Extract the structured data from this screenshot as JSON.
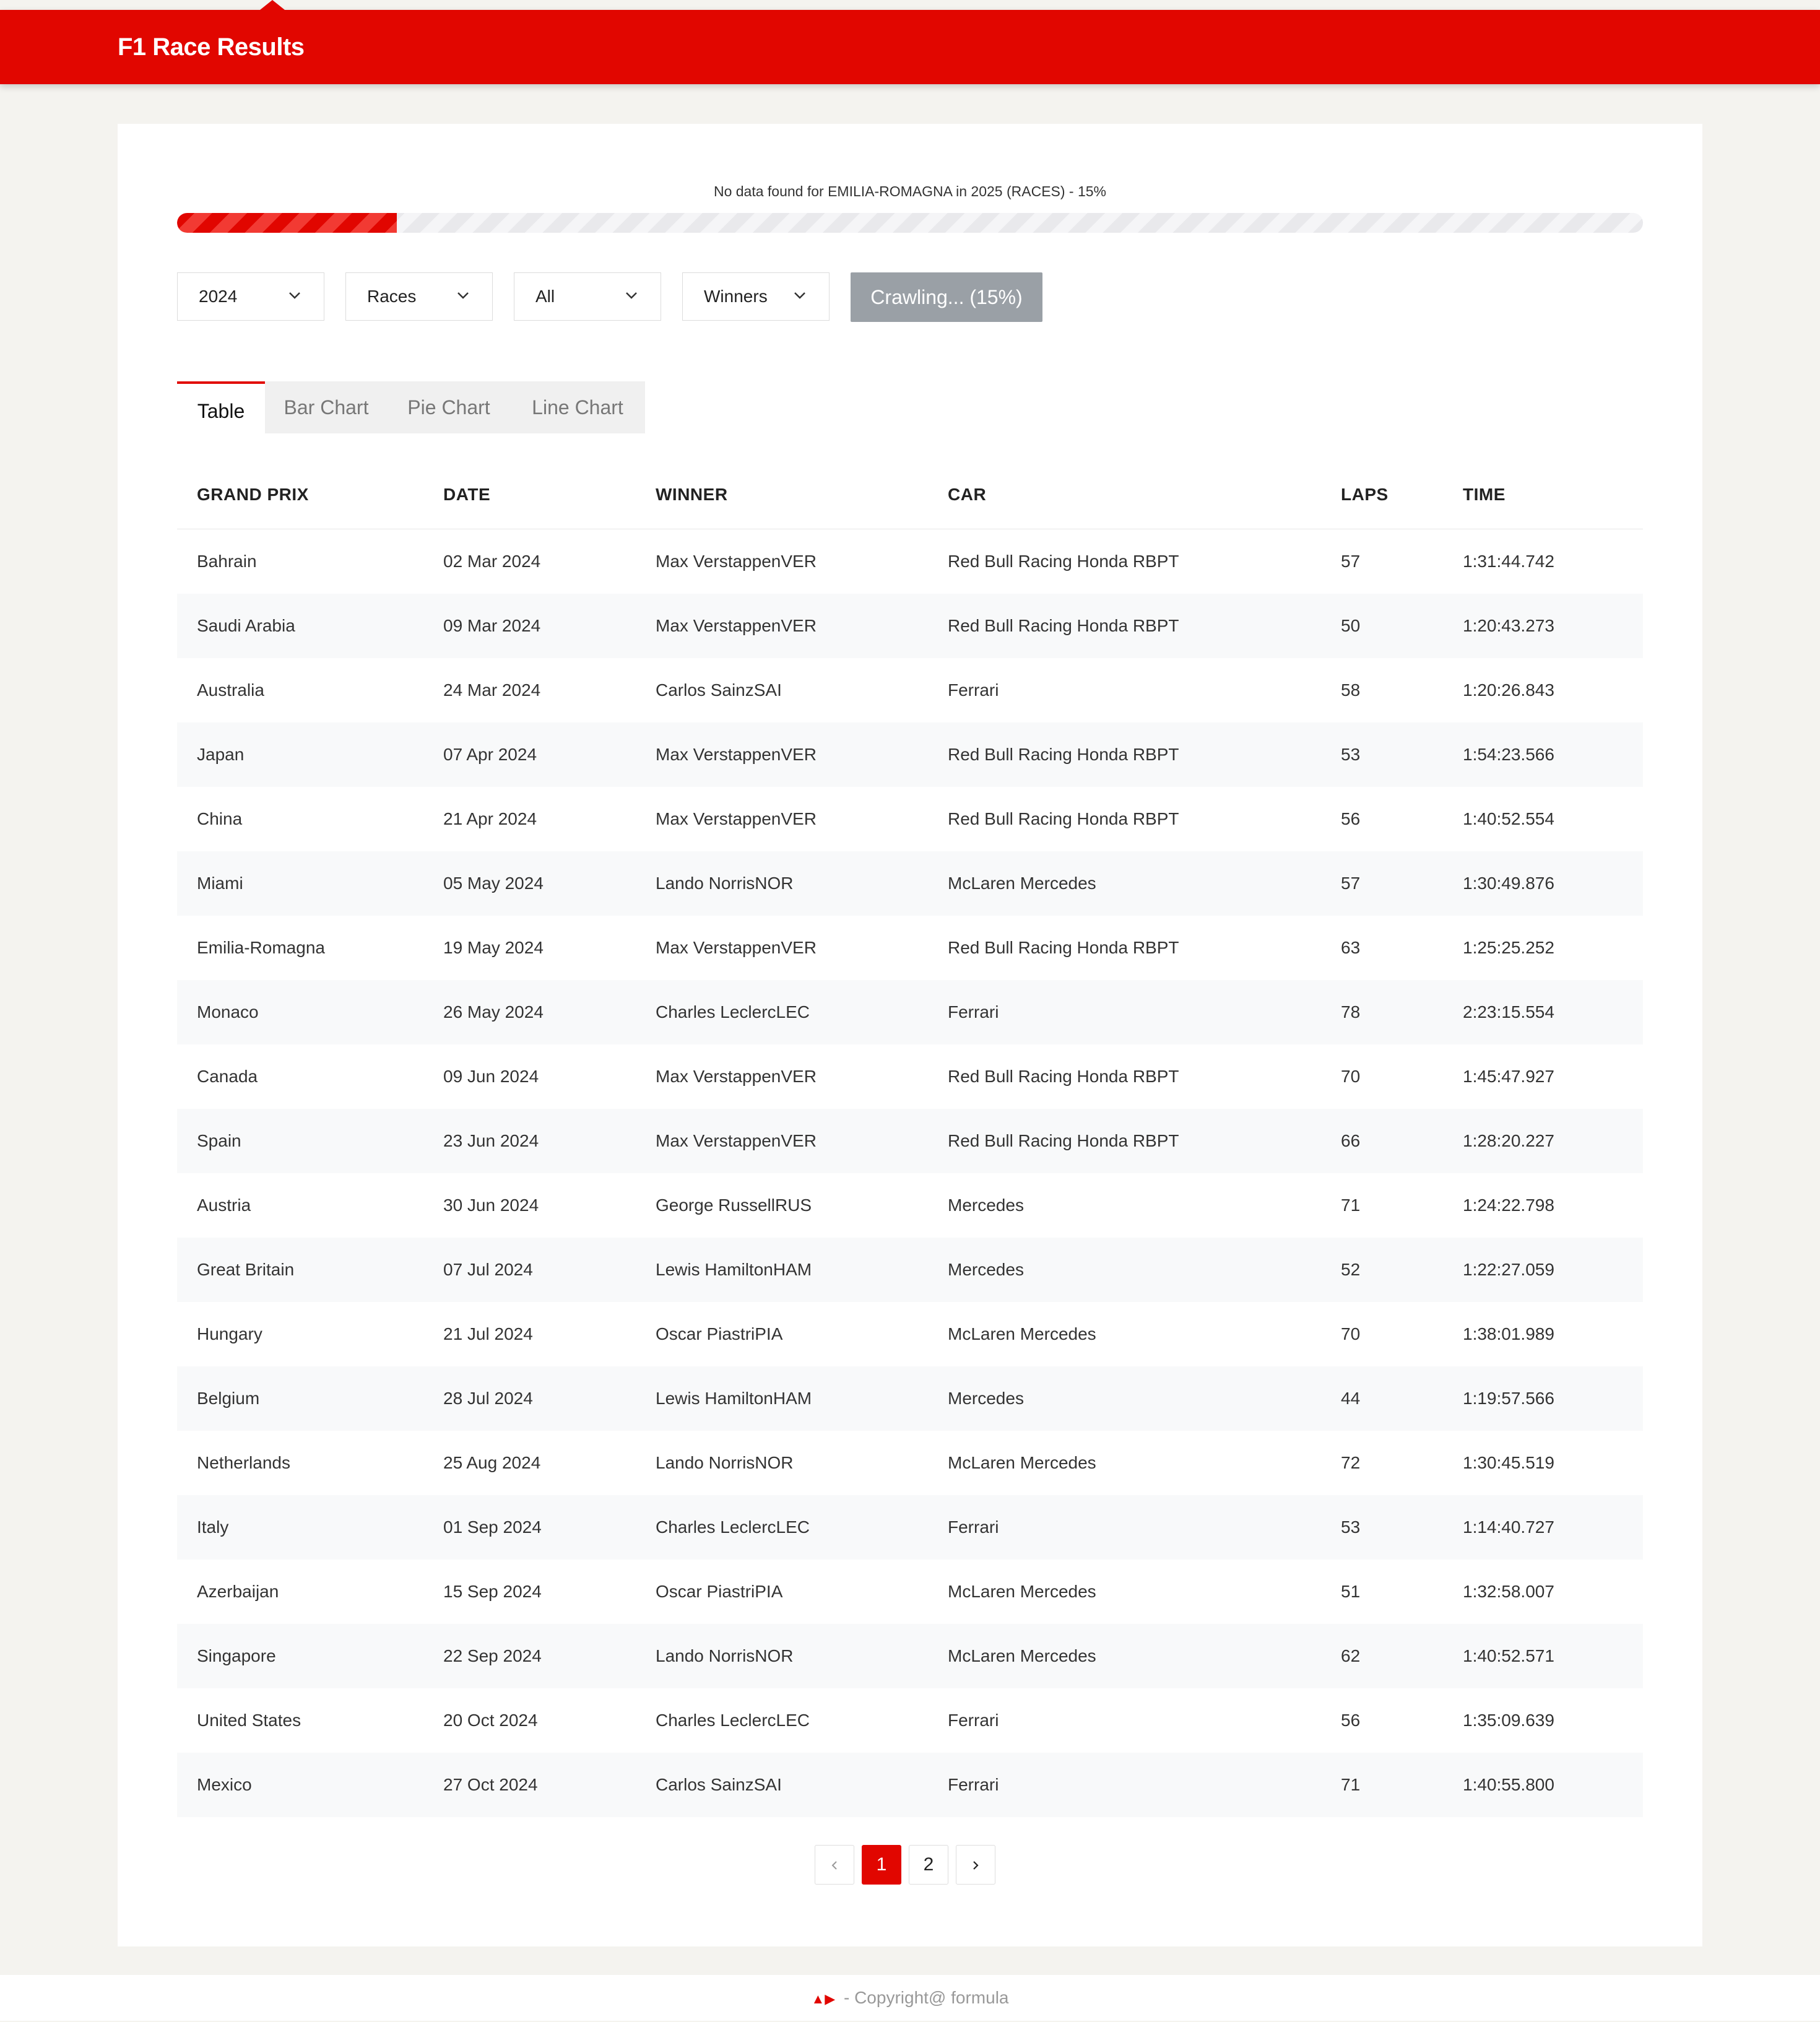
{
  "header": {
    "title": "F1 Race Results"
  },
  "progress": {
    "label": "No data found for EMILIA-ROMAGNA in 2025 (RACES) - 15%",
    "value": 0.15
  },
  "filters": {
    "year": "2024",
    "category": "Races",
    "scope": "All",
    "result_type": "Winners",
    "crawl_button": "Crawling... (15%)"
  },
  "tabs": [
    {
      "label": "Table",
      "active": true
    },
    {
      "label": "Bar Chart",
      "active": false
    },
    {
      "label": "Pie Chart",
      "active": false
    },
    {
      "label": "Line Chart",
      "active": false
    }
  ],
  "table": {
    "headers": [
      "GRAND PRIX",
      "DATE",
      "WINNER",
      "CAR",
      "LAPS",
      "TIME"
    ],
    "rows": [
      [
        "Bahrain",
        "02 Mar 2024",
        "Max VerstappenVER",
        "Red Bull Racing Honda RBPT",
        "57",
        "1:31:44.742"
      ],
      [
        "Saudi Arabia",
        "09 Mar 2024",
        "Max VerstappenVER",
        "Red Bull Racing Honda RBPT",
        "50",
        "1:20:43.273"
      ],
      [
        "Australia",
        "24 Mar 2024",
        "Carlos SainzSAI",
        "Ferrari",
        "58",
        "1:20:26.843"
      ],
      [
        "Japan",
        "07 Apr 2024",
        "Max VerstappenVER",
        "Red Bull Racing Honda RBPT",
        "53",
        "1:54:23.566"
      ],
      [
        "China",
        "21 Apr 2024",
        "Max VerstappenVER",
        "Red Bull Racing Honda RBPT",
        "56",
        "1:40:52.554"
      ],
      [
        "Miami",
        "05 May 2024",
        "Lando NorrisNOR",
        "McLaren Mercedes",
        "57",
        "1:30:49.876"
      ],
      [
        "Emilia-Romagna",
        "19 May 2024",
        "Max VerstappenVER",
        "Red Bull Racing Honda RBPT",
        "63",
        "1:25:25.252"
      ],
      [
        "Monaco",
        "26 May 2024",
        "Charles LeclercLEC",
        "Ferrari",
        "78",
        "2:23:15.554"
      ],
      [
        "Canada",
        "09 Jun 2024",
        "Max VerstappenVER",
        "Red Bull Racing Honda RBPT",
        "70",
        "1:45:47.927"
      ],
      [
        "Spain",
        "23 Jun 2024",
        "Max VerstappenVER",
        "Red Bull Racing Honda RBPT",
        "66",
        "1:28:20.227"
      ],
      [
        "Austria",
        "30 Jun 2024",
        "George RussellRUS",
        "Mercedes",
        "71",
        "1:24:22.798"
      ],
      [
        "Great Britain",
        "07 Jul 2024",
        "Lewis HamiltonHAM",
        "Mercedes",
        "52",
        "1:22:27.059"
      ],
      [
        "Hungary",
        "21 Jul 2024",
        "Oscar PiastriPIA",
        "McLaren Mercedes",
        "70",
        "1:38:01.989"
      ],
      [
        "Belgium",
        "28 Jul 2024",
        "Lewis HamiltonHAM",
        "Mercedes",
        "44",
        "1:19:57.566"
      ],
      [
        "Netherlands",
        "25 Aug 2024",
        "Lando NorrisNOR",
        "McLaren Mercedes",
        "72",
        "1:30:45.519"
      ],
      [
        "Italy",
        "01 Sep 2024",
        "Charles LeclercLEC",
        "Ferrari",
        "53",
        "1:14:40.727"
      ],
      [
        "Azerbaijan",
        "15 Sep 2024",
        "Oscar PiastriPIA",
        "McLaren Mercedes",
        "51",
        "1:32:58.007"
      ],
      [
        "Singapore",
        "22 Sep 2024",
        "Lando NorrisNOR",
        "McLaren Mercedes",
        "62",
        "1:40:52.571"
      ],
      [
        "United States",
        "20 Oct 2024",
        "Charles LeclercLEC",
        "Ferrari",
        "56",
        "1:35:09.639"
      ],
      [
        "Mexico",
        "27 Oct 2024",
        "Carlos SainzSAI",
        "Ferrari",
        "71",
        "1:40:55.800"
      ]
    ]
  },
  "pagination": {
    "prev": "‹",
    "pages": [
      "1",
      "2"
    ],
    "current": "1",
    "next": "›"
  },
  "footer": {
    "text": "- Copyright@ formula",
    "icon": "race-car-icon"
  },
  "colors": {
    "accent": "#e10600",
    "disabled": "#9aa0a6",
    "background": "#f4f3ef",
    "row_alt": "#f8f9fa"
  }
}
